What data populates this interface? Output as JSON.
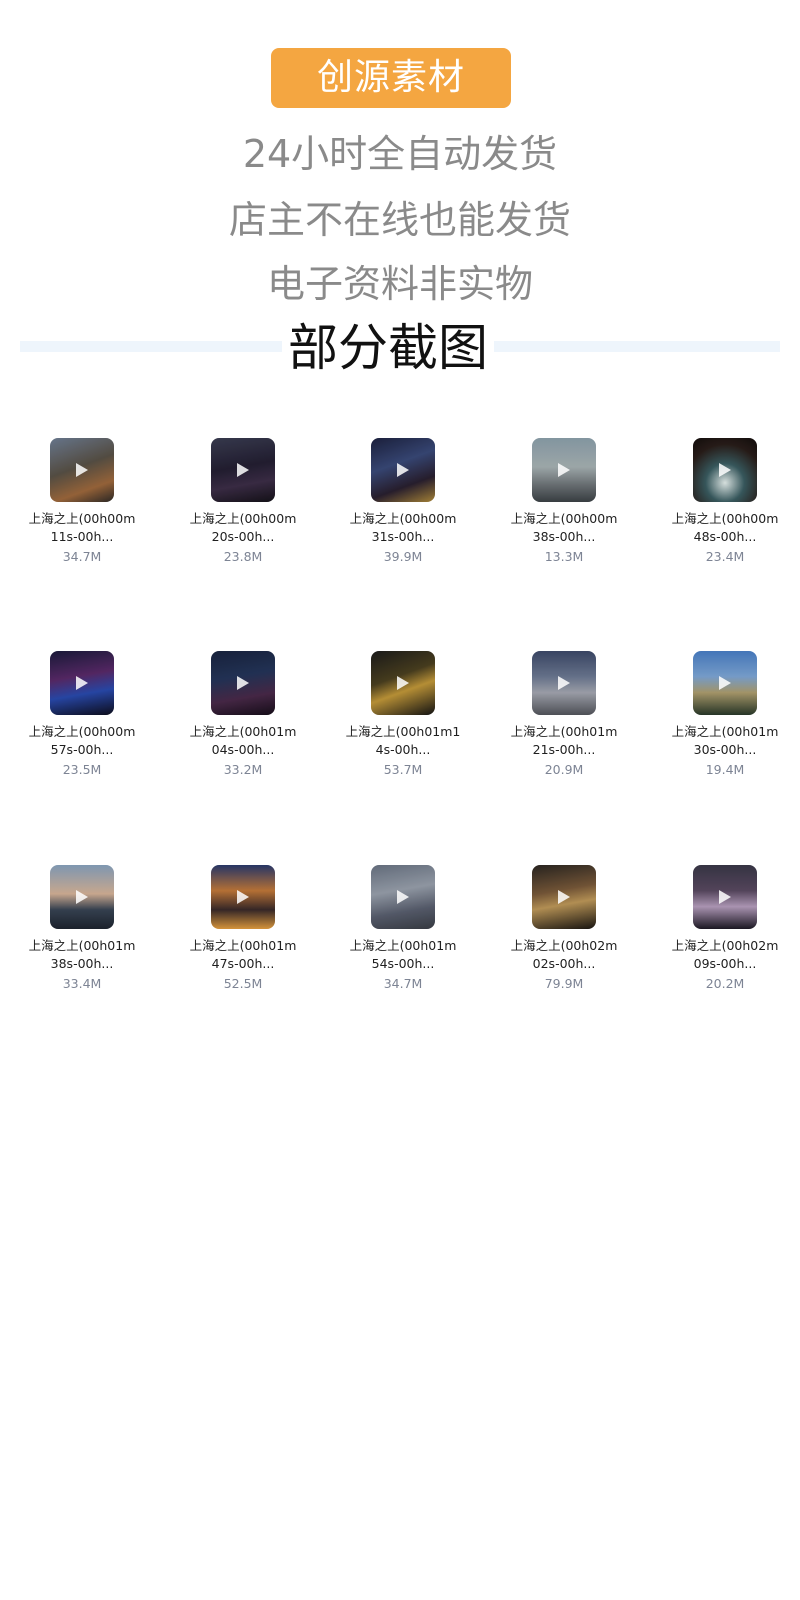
{
  "header": {
    "brand_label": "创源素材",
    "slogans": [
      "24小时全自动发货",
      "店主不在线也能发货",
      "电子资料非实物"
    ]
  },
  "section": {
    "title": "部分截图"
  },
  "colors": {
    "brand": "#f4a641",
    "slogan_text": "#8a8a8a",
    "divider": "#eef5fc",
    "size_text": "#7d8494"
  },
  "files": [
    {
      "name_line1": "上海之上(00h00m",
      "name_line2": "11s-00h...",
      "size": "34.7M",
      "icon": "play-icon"
    },
    {
      "name_line1": "上海之上(00h00m",
      "name_line2": "20s-00h...",
      "size": "23.8M",
      "icon": "play-icon"
    },
    {
      "name_line1": "上海之上(00h00m",
      "name_line2": "31s-00h...",
      "size": "39.9M",
      "icon": "play-icon"
    },
    {
      "name_line1": "上海之上(00h00m",
      "name_line2": "38s-00h...",
      "size": "13.3M",
      "icon": "play-icon"
    },
    {
      "name_line1": "上海之上(00h00m",
      "name_line2": "48s-00h...",
      "size": "23.4M",
      "icon": "play-icon"
    },
    {
      "name_line1": "上海之上(00h00m",
      "name_line2": "57s-00h...",
      "size": "23.5M",
      "icon": "play-icon"
    },
    {
      "name_line1": "上海之上(00h01m",
      "name_line2": "04s-00h...",
      "size": "33.2M",
      "icon": "play-icon"
    },
    {
      "name_line1": "上海之上(00h01m1",
      "name_line2": "4s-00h...",
      "size": "53.7M",
      "icon": "play-icon"
    },
    {
      "name_line1": "上海之上(00h01m",
      "name_line2": "21s-00h...",
      "size": "20.9M",
      "icon": "play-icon"
    },
    {
      "name_line1": "上海之上(00h01m",
      "name_line2": "30s-00h...",
      "size": "19.4M",
      "icon": "play-icon"
    },
    {
      "name_line1": "上海之上(00h01m",
      "name_line2": "38s-00h...",
      "size": "33.4M",
      "icon": "play-icon"
    },
    {
      "name_line1": "上海之上(00h01m",
      "name_line2": "47s-00h...",
      "size": "52.5M",
      "icon": "play-icon"
    },
    {
      "name_line1": "上海之上(00h01m",
      "name_line2": "54s-00h...",
      "size": "34.7M",
      "icon": "play-icon"
    },
    {
      "name_line1": "上海之上(00h02m",
      "name_line2": "02s-00h...",
      "size": "79.9M",
      "icon": "play-icon"
    },
    {
      "name_line1": "上海之上(00h02m",
      "name_line2": "09s-00h...",
      "size": "20.2M",
      "icon": "play-icon"
    }
  ]
}
